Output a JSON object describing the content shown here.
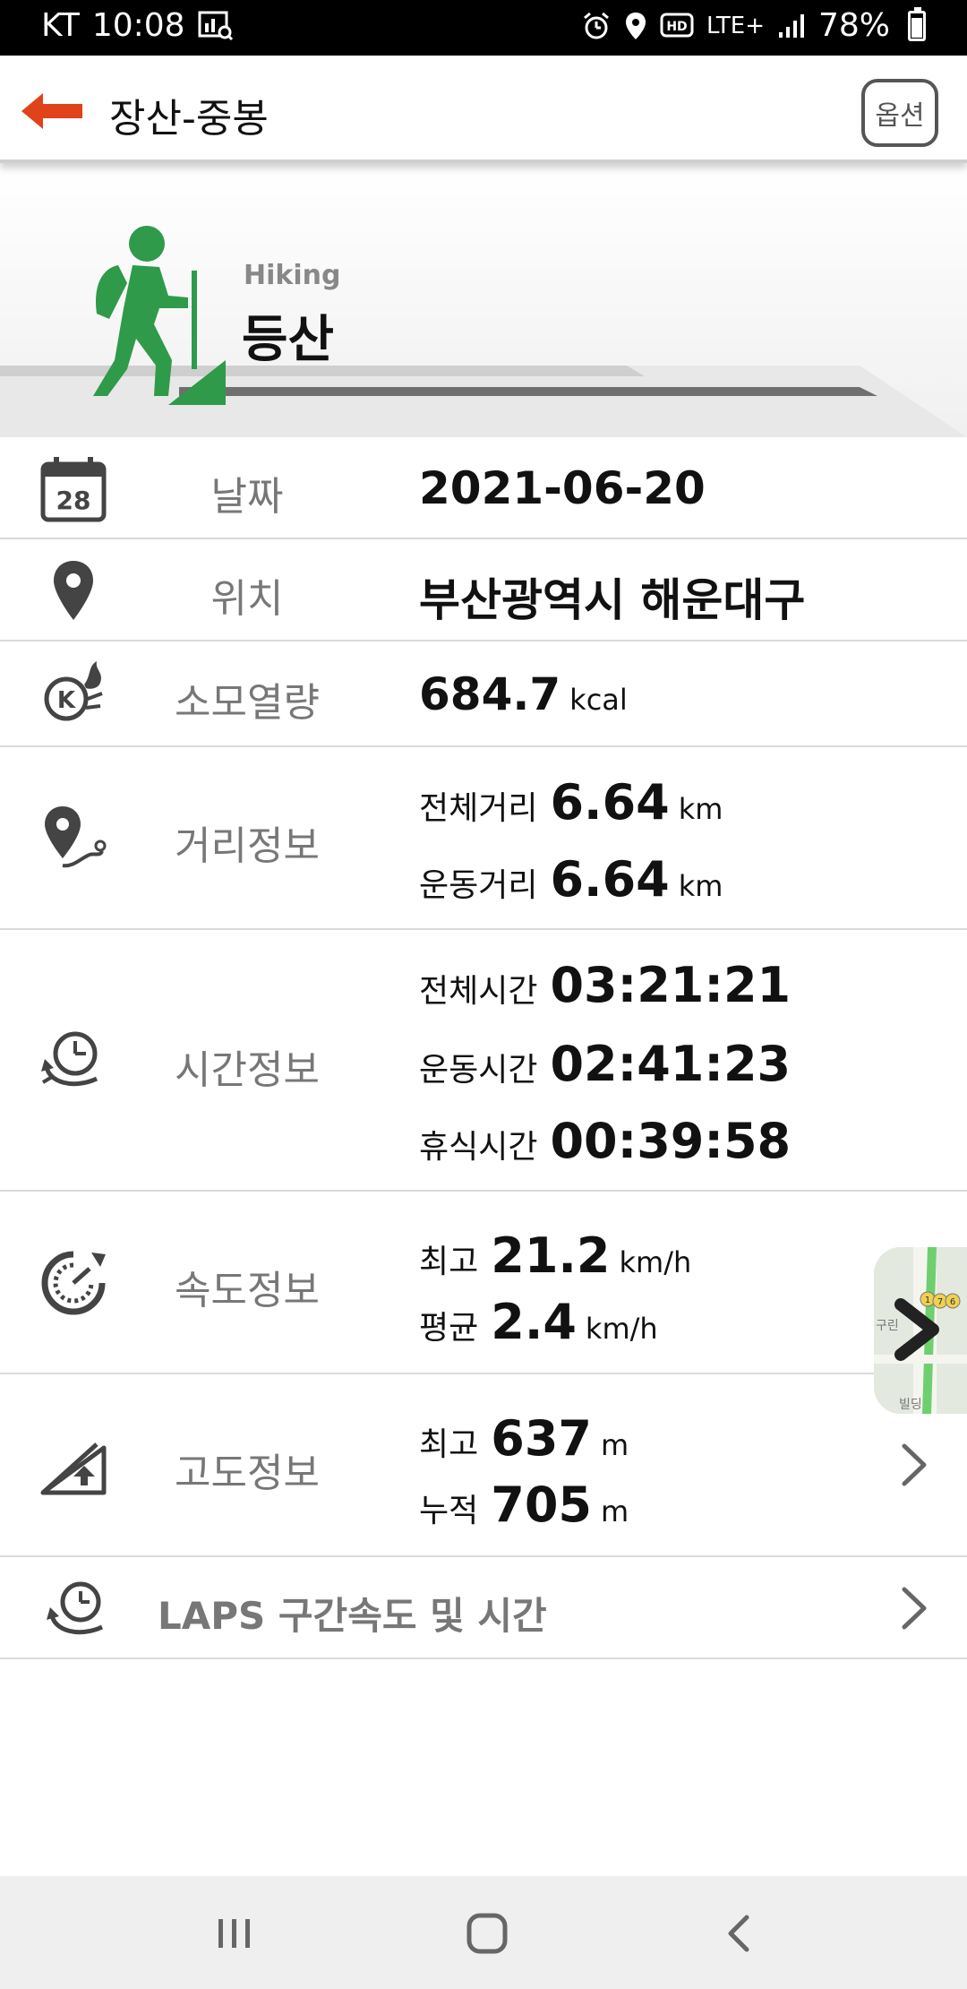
{
  "status_bar": {
    "carrier": "KT",
    "time": "10:08",
    "network": "LTE+",
    "battery": "78%"
  },
  "app_bar": {
    "title": "장산-중봉",
    "option_label": "옵션",
    "accent_color": "#e0421a"
  },
  "hero": {
    "subtitle": "Hiking",
    "title": "등산",
    "icon": "hiker-icon",
    "icon_color": "#2f9a4a"
  },
  "rows": {
    "date": {
      "label": "날짜",
      "value": "2021-06-20",
      "icon": "calendar-icon",
      "icon_text": "28"
    },
    "location": {
      "label": "위치",
      "value": "부산광역시 해운대구",
      "icon": "location-pin-icon"
    },
    "calories": {
      "label": "소모열량",
      "value": "684.7",
      "unit": "kcal",
      "icon": "calorie-flame-icon",
      "icon_text": "K"
    },
    "distance": {
      "label": "거리정보",
      "icon": "route-pin-icon",
      "lines": [
        {
          "key": "전체거리",
          "value": "6.64",
          "unit": "km"
        },
        {
          "key": "운동거리",
          "value": "6.64",
          "unit": "km"
        }
      ]
    },
    "time": {
      "label": "시간정보",
      "icon": "clock-cycle-icon",
      "lines": [
        {
          "key": "전체시간",
          "value": "03:21:21"
        },
        {
          "key": "운동시간",
          "value": "02:41:23"
        },
        {
          "key": "휴식시간",
          "value": "00:39:58"
        }
      ]
    },
    "speed": {
      "label": "속도정보",
      "icon": "speedometer-icon",
      "lines": [
        {
          "key": "최고",
          "value": "21.2",
          "unit": "km/h"
        },
        {
          "key": "평균",
          "value": "2.4",
          "unit": "km/h"
        }
      ]
    },
    "altitude": {
      "label": "고도정보",
      "icon": "altitude-slope-icon",
      "lines": [
        {
          "key": "최고",
          "value": "637",
          "unit": "m"
        },
        {
          "key": "누적",
          "value": "705",
          "unit": "m"
        }
      ]
    },
    "laps": {
      "label": "LAPS 구간속도 및 시간",
      "icon": "laps-clock-icon"
    }
  },
  "map_thumbnail": {
    "texts": [
      "1",
      "7",
      "6",
      "구린",
      "빌딩"
    ]
  },
  "nav_bar": {
    "recents_icon": "recents-icon",
    "home_icon": "home-icon",
    "back_icon": "back-icon"
  }
}
